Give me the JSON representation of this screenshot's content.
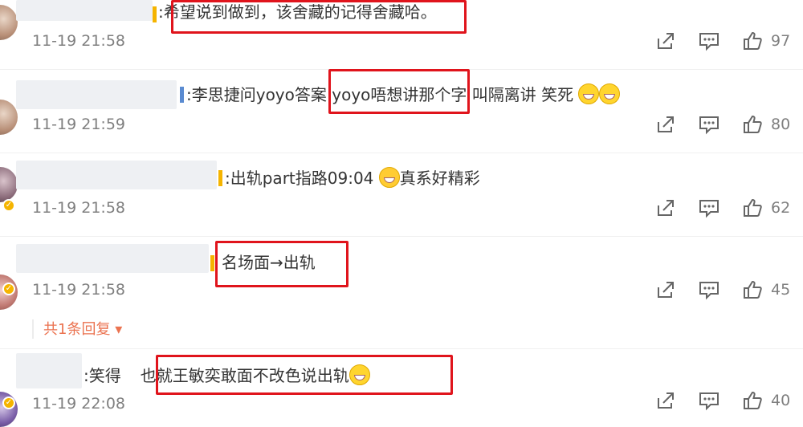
{
  "comments": [
    {
      "text": ":希望说到做到，该舍藏的记得舍藏哈。",
      "time": "11-19 21:58",
      "likes": "97",
      "highlight": "希望说到做到，该舍藏的记得舍藏哈。"
    },
    {
      "text_pre": ":李思捷问yoyo答案 ",
      "text_hl": "yoyo唔想讲那个字",
      "text_post": " 叫隔离讲 笑死",
      "time": "11-19 21:59",
      "likes": "80"
    },
    {
      "text_pre": ":出轨part指路09:04",
      "text_post": "真系好精彩",
      "time": "11-19 21:58",
      "likes": "62"
    },
    {
      "text": "名场面→出轨",
      "time": "11-19 21:58",
      "likes": "45",
      "replies": "共1条回复"
    },
    {
      "text_pre": ":笑得",
      "text_hl": "也就王敏奕敢面不改色说出轨",
      "time": "11-19 22:08",
      "likes": "40"
    }
  ],
  "icons": {
    "share": "share-icon",
    "comment": "comment-icon",
    "like": "thumbs-up-icon"
  },
  "colors": {
    "highlight_box": "#e0141c",
    "reply_link": "#eb7350",
    "vip_badge": "#f5b400",
    "name_bar": "#f5b400"
  }
}
